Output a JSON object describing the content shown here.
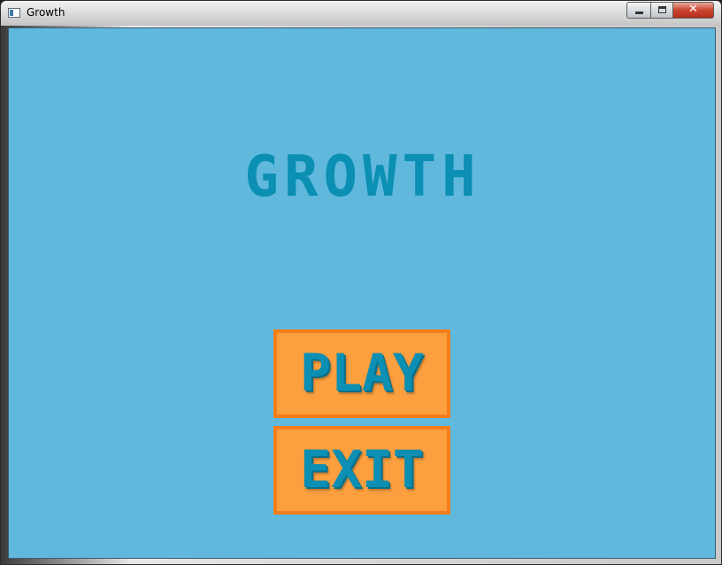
{
  "window": {
    "title": "Growth",
    "controls": {
      "minimize": "minimize",
      "maximize": "maximize",
      "close": "✕"
    }
  },
  "game": {
    "title": "GROWTH",
    "menu": {
      "play_label": "PLAY",
      "exit_label": "EXIT"
    }
  },
  "colors": {
    "background": "#60b8dd",
    "title_text": "#0b8fb3",
    "button_fill": "#fb9f3f",
    "button_border": "#f57d1a"
  }
}
